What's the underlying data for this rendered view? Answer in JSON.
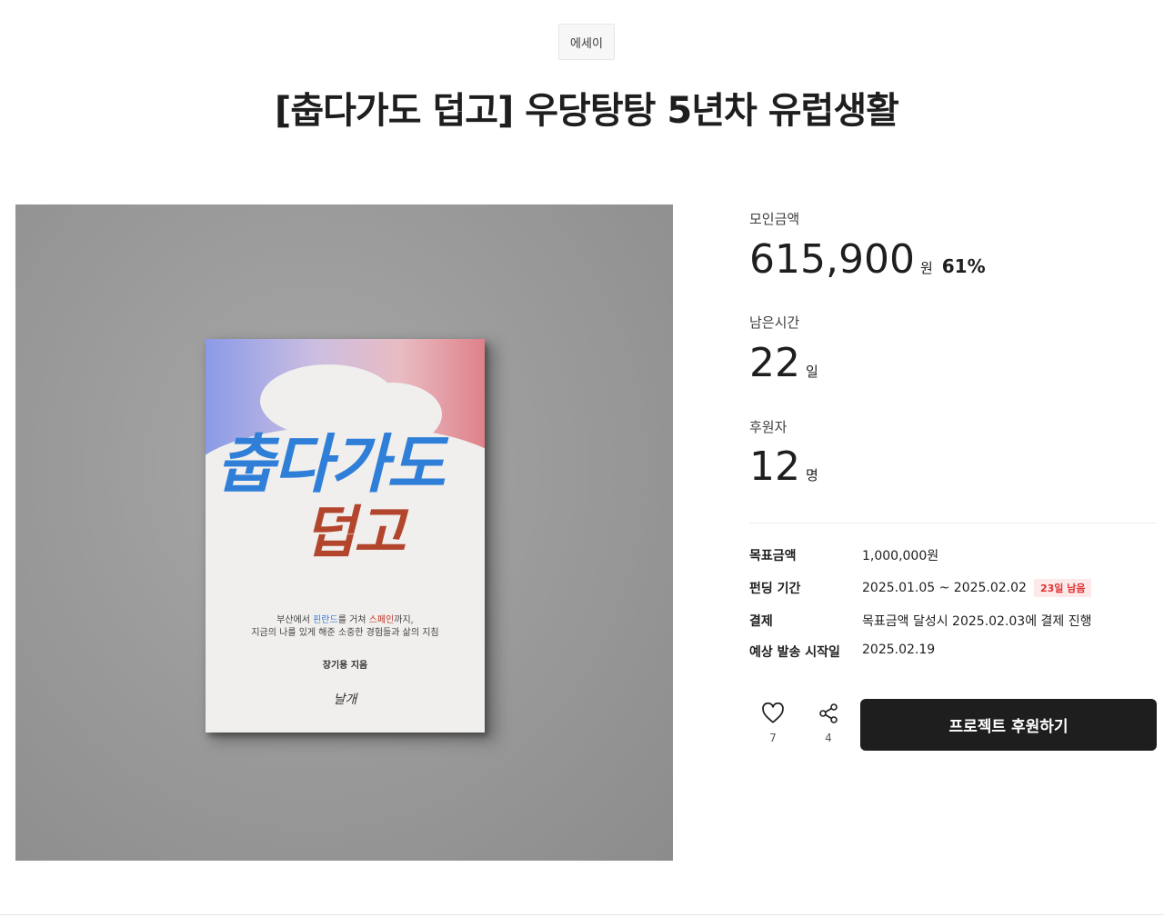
{
  "category": "에세이",
  "title": "[춥다가도 덥고] 우당탕탕 5년차 유럽생활",
  "cover": {
    "title_line1": "춥다가도",
    "title_line2": "덥고",
    "subtitle_line1_a": "부산에서 ",
    "subtitle_line1_b": "핀란드",
    "subtitle_line1_c": "를 거쳐 ",
    "subtitle_line1_d": "스페인",
    "subtitle_line1_e": "까지,",
    "subtitle_line2": "지금의 나를 있게 해준 소중한 경험들과 삶의 지침",
    "author": "장기용 지음",
    "publisher_logo": "날개"
  },
  "stats": {
    "raised_label": "모인금액",
    "raised_value": "615,900",
    "raised_unit": "원",
    "raised_percent": "61%",
    "time_label": "남은시간",
    "time_value": "22",
    "time_unit": "일",
    "backers_label": "후원자",
    "backers_value": "12",
    "backers_unit": "명"
  },
  "info": {
    "goal_key": "목표금액",
    "goal_val": "1,000,000원",
    "period_key": "펀딩 기간",
    "period_val": "2025.01.05 ~ 2025.02.02",
    "period_badge": "23일 남음",
    "payment_key": "결제",
    "payment_val": "목표금액 달성시 2025.02.03에 결제 진행",
    "delivery_key": "예상 발송 시작일",
    "delivery_val": "2025.02.19"
  },
  "actions": {
    "like_count": "7",
    "share_count": "4",
    "support_label": "프로젝트 후원하기"
  },
  "colors": {
    "primary_button": "#1e1e1e",
    "badge_text": "#e03131",
    "badge_bg": "#fde9e9"
  }
}
